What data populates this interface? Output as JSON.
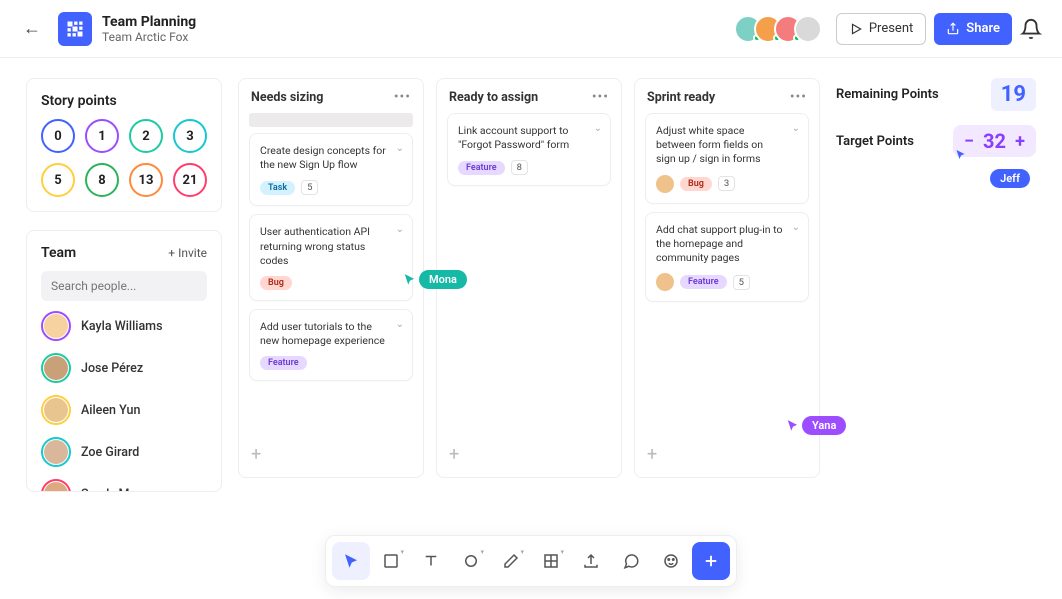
{
  "header": {
    "title": "Team Planning",
    "subtitle": "Team Arctic Fox",
    "present_label": "Present",
    "share_label": "Share"
  },
  "story_points": {
    "title": "Story points",
    "values": [
      "0",
      "1",
      "2",
      "3",
      "5",
      "8",
      "13",
      "21"
    ],
    "colors": [
      "#4262ff",
      "#9b4dff",
      "#1ecba0",
      "#17c7d1",
      "#ffcf3d",
      "#2db35a",
      "#ff8a3d",
      "#ff3d6e"
    ]
  },
  "team": {
    "title": "Team",
    "invite_label": "+ Invite",
    "search_placeholder": "Search people...",
    "members": [
      {
        "name": "Kayla Williams",
        "ring": "#9b4dff",
        "bg": "#f6d2a0"
      },
      {
        "name": "Jose Pérez",
        "ring": "#1ecba0",
        "bg": "#c9a178"
      },
      {
        "name": "Aileen Yun",
        "ring": "#ffcf3d",
        "bg": "#e8c58e"
      },
      {
        "name": "Zoe Girard",
        "ring": "#17c7d1",
        "bg": "#d8b79a"
      },
      {
        "name": "Sandy Moreau",
        "ring": "#ff3d6e",
        "bg": "#e0a87f"
      }
    ]
  },
  "board": {
    "columns": [
      {
        "title": "Needs sizing",
        "show_placeholder": true,
        "cards": [
          {
            "title": "Create design concepts for the new Sign Up flow",
            "pills": [
              {
                "type": "task",
                "label": "Task"
              }
            ],
            "count": "5"
          },
          {
            "title": "User authentication API returning wrong status codes",
            "pills": [
              {
                "type": "bug",
                "label": "Bug"
              }
            ]
          },
          {
            "title": "Add user tutorials to the new homepage experience",
            "pills": [
              {
                "type": "feature",
                "label": "Feature"
              }
            ]
          }
        ]
      },
      {
        "title": "Ready to assign",
        "cards": [
          {
            "title": "Link account support to \"Forgot Password\" form",
            "pills": [
              {
                "type": "feature",
                "label": "Feature"
              }
            ],
            "count": "8"
          }
        ]
      },
      {
        "title": "Sprint ready",
        "cards": [
          {
            "title": "Adjust white space between form fields on sign up / sign in forms",
            "avatar": true,
            "pills": [
              {
                "type": "bug",
                "label": "Bug"
              }
            ],
            "count": "3"
          },
          {
            "title": "Add chat support plug-in to the homepage and community pages",
            "avatar": true,
            "pills": [
              {
                "type": "feature",
                "label": "Feature"
              }
            ],
            "count": "5"
          }
        ]
      }
    ]
  },
  "metrics": {
    "remaining_label": "Remaining Points",
    "remaining_value": "19",
    "target_label": "Target Points",
    "target_value": "32"
  },
  "cursors": {
    "mona": "Mona",
    "yana": "Yana",
    "jeff": "Jeff"
  },
  "header_avatars": [
    {
      "bg": "#7cd1c4"
    },
    {
      "bg": "#f4a04a"
    },
    {
      "bg": "#f47c7c"
    },
    {
      "bg": "#d9d9d9"
    }
  ]
}
